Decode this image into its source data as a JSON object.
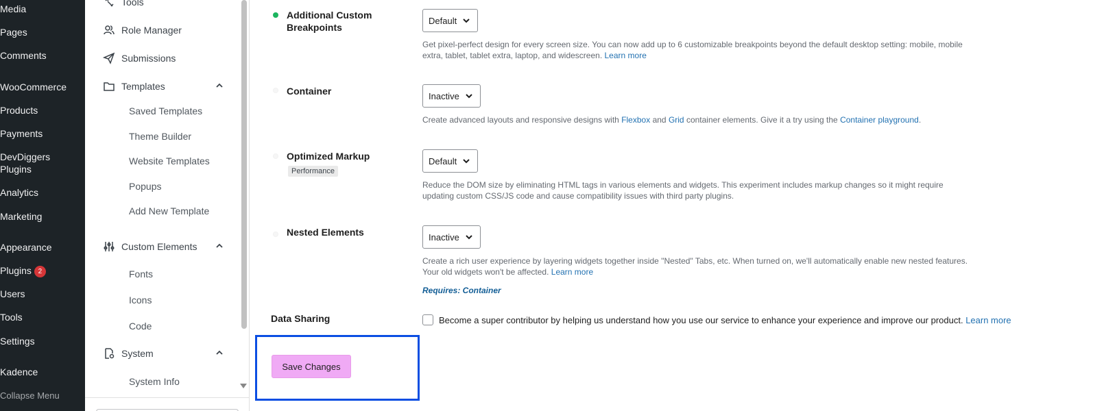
{
  "wp_menu": {
    "items": [
      {
        "label": "Media"
      },
      {
        "label": "Pages"
      },
      {
        "label": "Comments"
      },
      {
        "label": "WooCommerce"
      },
      {
        "label": "Products"
      },
      {
        "label": "Payments"
      },
      {
        "label": "DevDiggers Plugins"
      },
      {
        "label": "Analytics"
      },
      {
        "label": "Marketing"
      },
      {
        "label": "Appearance"
      },
      {
        "label": "Plugins",
        "badge": "2"
      },
      {
        "label": "Users"
      },
      {
        "label": "Tools"
      },
      {
        "label": "Settings"
      },
      {
        "label": "Kadence"
      }
    ],
    "collapse_label": "Collapse Menu"
  },
  "sub_menu": {
    "tools": "Tools",
    "role_manager": "Role Manager",
    "submissions": "Submissions",
    "templates": {
      "label": "Templates",
      "children": [
        "Saved Templates",
        "Theme Builder",
        "Website Templates",
        "Popups",
        "Add New Template"
      ]
    },
    "custom_elements": {
      "label": "Custom Elements",
      "children": [
        "Fonts",
        "Icons",
        "Code"
      ]
    },
    "system": {
      "label": "System",
      "children": [
        "System Info"
      ]
    }
  },
  "experiments": [
    {
      "title": "Additional Custom Breakpoints",
      "status": "active",
      "select_value": "Default",
      "desc_before": "Get pixel-perfect design for every screen size. You can now add up to 6 customizable breakpoints beyond the default desktop setting: mobile, mobile extra, tablet, tablet extra, laptop, and widescreen.",
      "link_learn_more": "Learn more"
    },
    {
      "title": "Container",
      "status": "inactive",
      "select_value": "Inactive",
      "desc_part1": "Create advanced layouts and responsive designs with",
      "link_flexbox": "Flexbox",
      "desc_and": "and",
      "link_grid": "Grid",
      "desc_part2": "container elements. Give it a try using the",
      "link_playground": "Container playground",
      "desc_end": "."
    },
    {
      "title": "Optimized Markup",
      "tag": "Performance",
      "status": "inactive",
      "select_value": "Default",
      "desc": "Reduce the DOM size by eliminating HTML tags in various elements and widgets. This experiment includes markup changes so it might require updating custom CSS/JS code and cause compatibility issues with third party plugins."
    },
    {
      "title": "Nested Elements",
      "status": "inactive",
      "select_value": "Inactive",
      "desc_before": "Create a rich user experience by layering widgets together inside \"Nested\" Tabs, etc. When turned on, we'll automatically enable new nested features. Your old widgets won't be affected.",
      "link_learn_more": "Learn more",
      "requires": "Requires: Container"
    }
  ],
  "data_sharing": {
    "label": "Data Sharing",
    "text": "Become a super contributor by helping us understand how you use our service to enhance your experience and improve our product.",
    "link": "Learn more",
    "checked": false
  },
  "save_button": "Save Changes",
  "colors": {
    "wp_sidebar_bg": "#1d2327",
    "active_dot": "#1cb55f",
    "link": "#2271b1",
    "save_button_bg": "#f0aaf5",
    "highlight_border": "#0b4ee2"
  }
}
